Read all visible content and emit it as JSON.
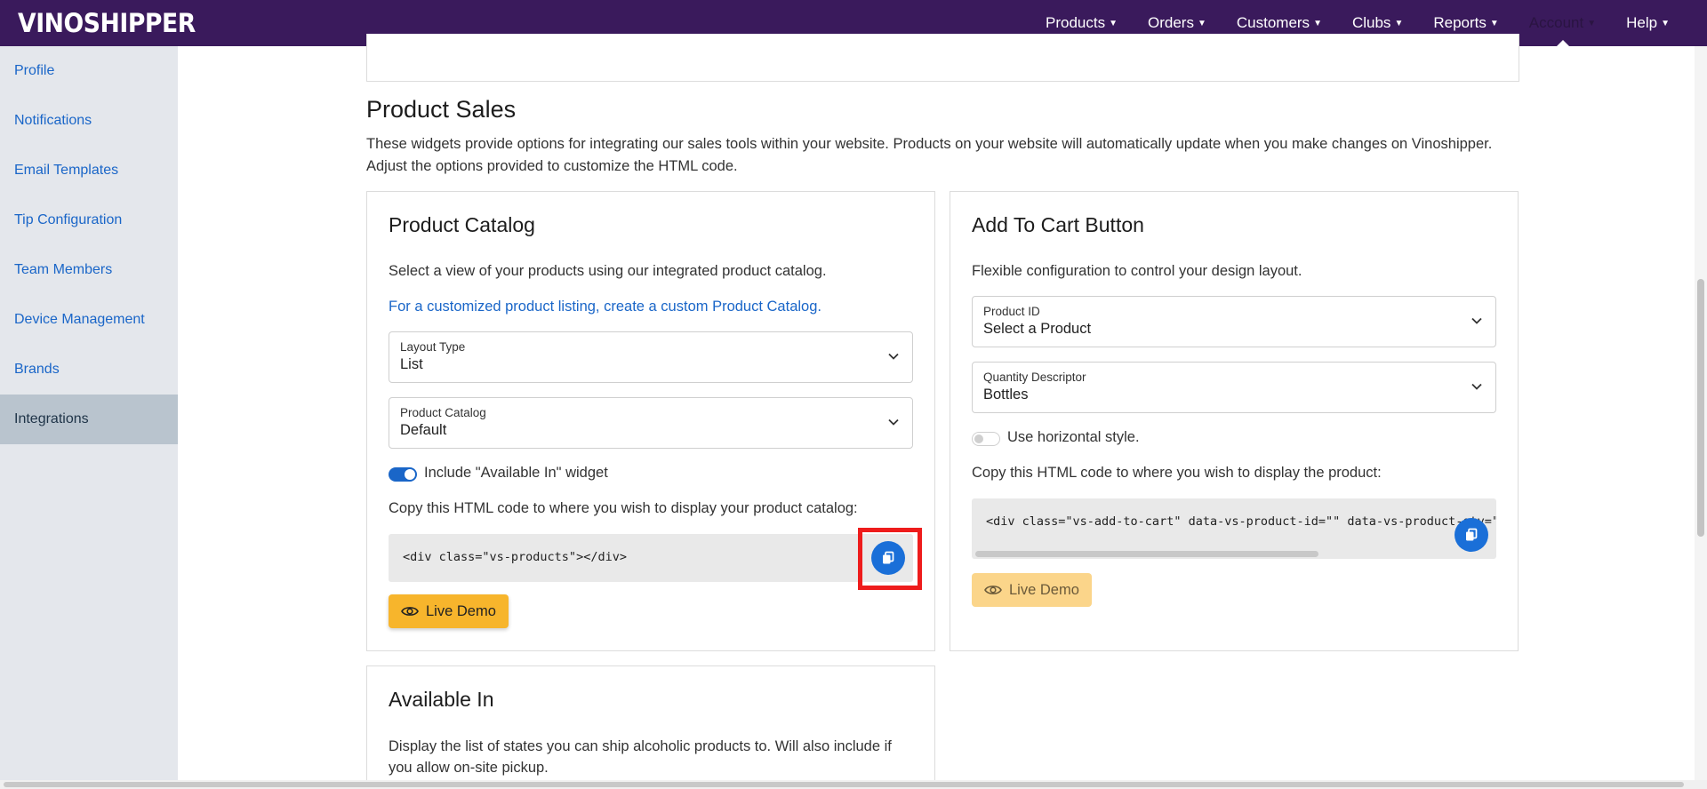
{
  "header": {
    "logo": "VINOSHIPPER",
    "nav": [
      {
        "label": "Products"
      },
      {
        "label": "Orders"
      },
      {
        "label": "Customers"
      },
      {
        "label": "Clubs"
      },
      {
        "label": "Reports"
      },
      {
        "label": "Account"
      },
      {
        "label": "Help"
      }
    ],
    "active_nav": "Account",
    "bg_color": "#3a1a5c"
  },
  "sidebar": {
    "items": [
      {
        "label": "Profile"
      },
      {
        "label": "Notifications"
      },
      {
        "label": "Email Templates"
      },
      {
        "label": "Tip Configuration"
      },
      {
        "label": "Team Members"
      },
      {
        "label": "Device Management"
      },
      {
        "label": "Brands"
      },
      {
        "label": "Integrations"
      }
    ],
    "active": "Integrations"
  },
  "main": {
    "section_title": "Product Sales",
    "section_desc": "These widgets provide options for integrating our sales tools within your website. Products on your website will automatically update when you make changes on Vinoshipper. Adjust the options provided to customize the HTML code.",
    "product_catalog": {
      "title": "Product Catalog",
      "desc": "Select a view of your products using our integrated product catalog.",
      "link": "For a customized product listing, create a custom Product Catalog.",
      "layout_type": {
        "label": "Layout Type",
        "value": "List"
      },
      "catalog": {
        "label": "Product Catalog",
        "value": "Default"
      },
      "toggle_label": "Include \"Available In\" widget",
      "toggle_on": true,
      "copy_instructions": "Copy this HTML code to where you wish to display your product catalog:",
      "code": "<div class=\"vs-products\"></div>",
      "demo_label": "Live Demo"
    },
    "add_to_cart": {
      "title": "Add To Cart Button",
      "desc": "Flexible configuration to control your design layout.",
      "product_id": {
        "label": "Product ID",
        "value": "Select a Product"
      },
      "quantity": {
        "label": "Quantity Descriptor",
        "value": "Bottles"
      },
      "toggle_label": "Use horizontal style.",
      "toggle_on": false,
      "copy_instructions": "Copy this HTML code to where you wish to display the product:",
      "code": "<div class=\"vs-add-to-cart\" data-vs-product-id=\"\" data-vs-product-qty=\"Bottles\"></div>",
      "demo_label": "Live Demo"
    },
    "available_in": {
      "title": "Available In",
      "desc": "Display the list of states you can ship alcoholic products to. Will also include if you allow on-site pickup."
    }
  },
  "colors": {
    "accent": "#1a66c8",
    "copy_button": "#1a6fd8",
    "demo_button": "#f7b52c",
    "highlight": "#ee1c1c"
  }
}
